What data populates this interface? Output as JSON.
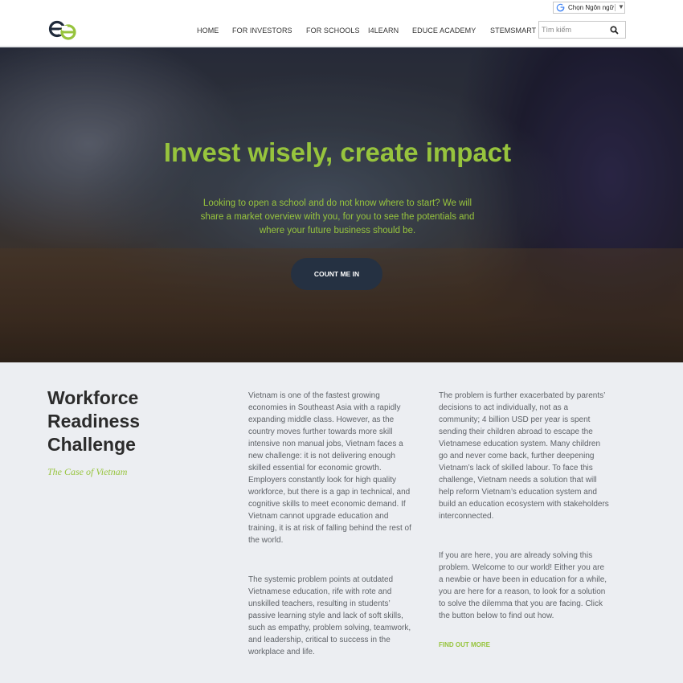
{
  "header": {
    "language_label": "Chọn Ngôn ngữ",
    "search_placeholder": "Tìm kiếm",
    "nav": [
      "HOME",
      "FOR INVESTORS",
      "FOR SCHOOLS",
      "I4LEARN",
      "EDUCE ACADEMY",
      "STEMSMART"
    ],
    "logo_icon": "educe-logo-icon",
    "search_icon": "magnifier-icon"
  },
  "hero": {
    "title": "Invest wisely, create impact",
    "text": "Looking to open a school and do not know where to start? We will share a market overview with you, for you to see the potentials and where your future business should be.",
    "cta_label": "COUNT ME IN"
  },
  "section": {
    "title": "Workforce Readiness Challenge",
    "subtitle": "The Case of Vietnam",
    "col1_p1": "Vietnam is one of the fastest growing economies in Southeast Asia with a rapidly expanding middle class. However, as the country moves further towards more skill intensive non manual jobs, Vietnam faces a new challenge: it is not delivering enough skilled essential for economic growth. Employers constantly look for high quality workforce, but there is a gap in technical, and cognitive skills to meet economic demand. If Vietnam cannot upgrade education and training, it is at risk of falling behind the rest of the world.",
    "col1_p2": "The systemic problem points at outdated Vietnamese education, rife with rote and unskilled teachers, resulting in students’ passive learning style and lack of soft skills, such as empathy, problem solving, teamwork, and leadership, critical to success in the workplace and life.",
    "col2_p1": "The problem is further exacerbated by parents’ decisions to act individually, not as a community; 4 billion USD per year is spent sending their children abroad to escape the Vietnamese education system. Many children go and never come back, further deepening Vietnam’s lack of skilled labour. To face this challenge, Vietnam needs a solution that will help reform Vietnam’s education system and build an education ecosystem with stakeholders interconnected.",
    "col2_p2": "If you are here, you are already solving this problem. Welcome to our world! Either you are a newbie or have been in education for a while, you are here for a reason, to look for a solution to solve the dilemma that you are facing. Click the button below to find out how.",
    "link_label": "FIND OUT MORE"
  },
  "colors": {
    "accent_green": "#97c43d",
    "button_navy": "#253142",
    "content_bg": "#eceef2"
  }
}
